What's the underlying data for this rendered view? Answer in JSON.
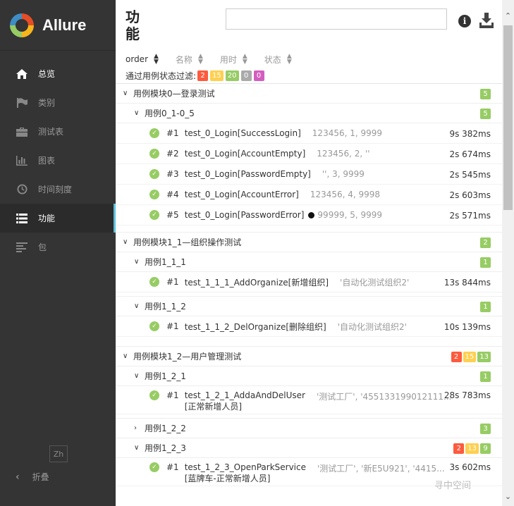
{
  "app": {
    "name": "Allure"
  },
  "nav": {
    "items": [
      {
        "label": "总览",
        "icon": "home-icon"
      },
      {
        "label": "类别",
        "icon": "flag-icon"
      },
      {
        "label": "测试表",
        "icon": "briefcase-icon"
      },
      {
        "label": "图表",
        "icon": "bar-chart-icon"
      },
      {
        "label": "时间刻度",
        "icon": "clock-icon"
      },
      {
        "label": "功能",
        "icon": "list-icon"
      },
      {
        "label": "包",
        "icon": "align-left-icon"
      }
    ],
    "active_index": 5,
    "language": "Zh",
    "collapse_label": "折叠"
  },
  "header": {
    "title": "功能",
    "search_value": ""
  },
  "sort": {
    "order": "order",
    "name": "名称",
    "duration": "用时",
    "status": "状态"
  },
  "filter": {
    "label": "通过用例状态过滤:",
    "counts": {
      "failed": "2",
      "broken": "15",
      "passed": "20",
      "skipped": "0",
      "unknown": "0"
    }
  },
  "modules": [
    {
      "title": "用例模块0—登录测试",
      "badges": {
        "passed": "5"
      },
      "groups": [
        {
          "title": "用例0_1-0_5",
          "badges": {
            "passed": "5"
          },
          "cases": [
            {
              "num": "#1",
              "name": "test_0_Login[SuccessLogin]",
              "params": "123456, 1, 9999",
              "duration": "9s 382ms"
            },
            {
              "num": "#2",
              "name": "test_0_Login[AccountEmpty]",
              "params": "123456, 2, ''",
              "duration": "2s 674ms"
            },
            {
              "num": "#3",
              "name": "test_0_Login[PasswordEmpty]",
              "params": "'', 3, 9999",
              "duration": "2s 545ms"
            },
            {
              "num": "#4",
              "name": "test_0_Login[AccountError]",
              "params": "123456, 4, 9998",
              "duration": "2s 603ms"
            },
            {
              "num": "#5",
              "name": "test_0_Login[PasswordError]",
              "params": "99999, 5, 9999",
              "duration": "2s 571ms"
            }
          ]
        }
      ]
    },
    {
      "title": "用例模块1_1—组织操作测试",
      "badges": {
        "passed": "2"
      },
      "groups": [
        {
          "title": "用例1_1_1",
          "badges": {
            "passed": "1"
          },
          "cases": [
            {
              "num": "#1",
              "name": "test_1_1_1_AddOrganize[新增组织]",
              "params": "'自动化测试组织2'",
              "duration": "13s 844ms"
            }
          ]
        },
        {
          "title": "用例1_1_2",
          "badges": {
            "passed": "1"
          },
          "cases": [
            {
              "num": "#1",
              "name": "test_1_1_2_DelOrganize[删除组织]",
              "params": "'自动化测试组织2'",
              "duration": "10s 139ms"
            }
          ]
        }
      ]
    },
    {
      "title": "用例模块1_2—用户管理测试",
      "badges": {
        "failed": "2",
        "broken": "15",
        "passed": "13"
      },
      "groups": [
        {
          "title": "用例1_2_1",
          "badges": {
            "passed": "1"
          },
          "cases": [
            {
              "num": "#1",
              "name": "test_1_2_1_AddaAndDelUser",
              "name2": "[正常新增人员]",
              "params": "'测试工厂', '455133199012111...",
              "duration": "28s 783ms"
            }
          ]
        },
        {
          "title": "用例1_2_2",
          "badges": {
            "passed": "3"
          },
          "cases": []
        },
        {
          "title": "用例1_2_3",
          "badges": {
            "failed": "2",
            "broken": "13",
            "passed": "9"
          },
          "cases": [
            {
              "num": "#1",
              "name": "test_1_2_3_OpenParkService",
              "name2": "[蓝牌车-正常新增人员]",
              "params": "'测试工厂', '新E5U921', '4415...",
              "duration": "3s 602ms"
            }
          ]
        }
      ]
    }
  ],
  "watermark": "寻中空间"
}
